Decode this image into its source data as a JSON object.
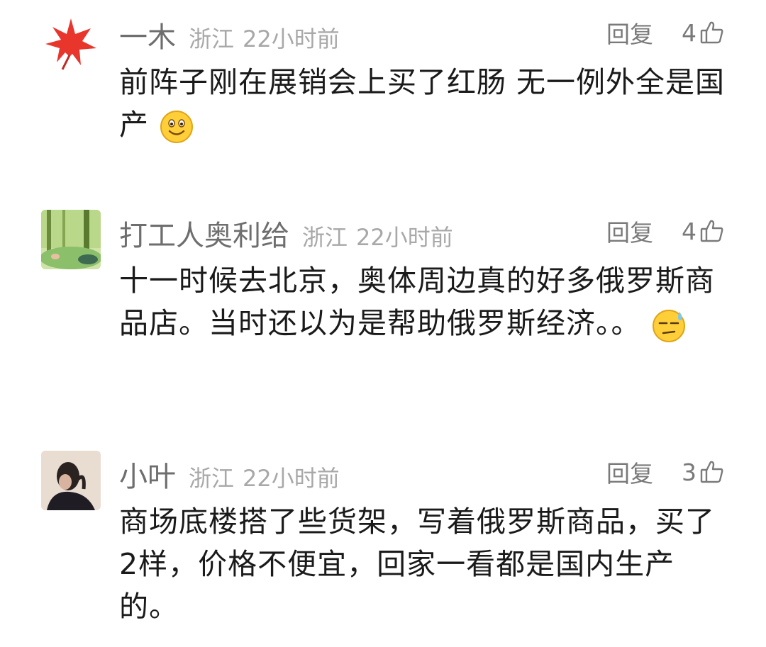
{
  "comments": [
    {
      "avatar": "red-maple-leaf-avatar",
      "username": "一木",
      "location": "浙江",
      "time": "22小时前",
      "reply_label": "回复",
      "likes": "4",
      "text": "前阵子刚在展销会上买了红肠  无一例外全是国产",
      "emoji": "smiling-face-emoji"
    },
    {
      "avatar": "forest-scene-avatar",
      "username": "打工人奥利给",
      "location": "浙江",
      "time": "22小时前",
      "reply_label": "回复",
      "likes": "4",
      "text": "十一时候去北京，奥体周边真的好多俄罗斯商品店。当时还以为是帮助俄罗斯经济。。",
      "emoji": "sweat-face-emoji"
    },
    {
      "avatar": "person-photo-avatar",
      "username": "小叶",
      "location": "浙江",
      "time": "22小时前",
      "reply_label": "回复",
      "likes": "3",
      "text": "商场底楼搭了些货架，写着俄罗斯商品，买了2样，价格不便宜，回家一看都是国内生产的。",
      "emoji": ""
    }
  ],
  "icons": {
    "like": "thumbs-up-icon"
  },
  "colors": {
    "username": "#6e6e6e",
    "meta": "#a8a8a8",
    "action": "#7a7a7a",
    "text": "#1a1a1a"
  }
}
